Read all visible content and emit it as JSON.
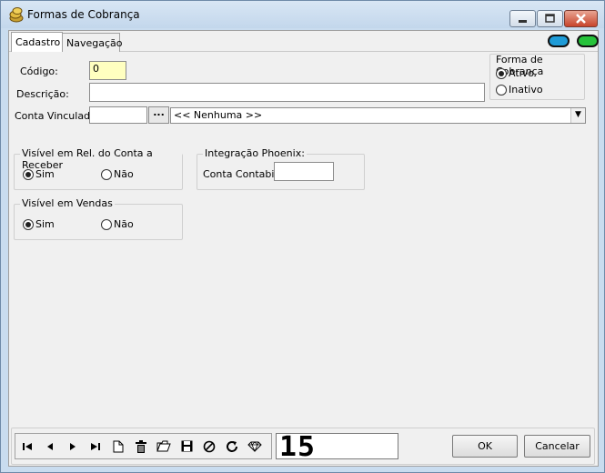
{
  "window": {
    "title": "Formas de Cobrança"
  },
  "tabs": [
    {
      "label": "Cadastro",
      "active": true
    },
    {
      "label": "Navegação",
      "active": false
    }
  ],
  "indicators": {
    "pill1_color": "#1e9bd7",
    "pill2_color": "#26c23a"
  },
  "form": {
    "codigo_label": "Código:",
    "codigo_value": "0",
    "descricao_label": "Descrição:",
    "descricao_value": "",
    "conta_label": "Conta Vinculada:",
    "conta_value": "",
    "conta_button": "...",
    "conta_combo_value": "<< Nenhuma >>"
  },
  "forma_group": {
    "title": "Forma de Cobrança",
    "options": [
      {
        "label": "Ativo",
        "checked": true
      },
      {
        "label": "Inativo",
        "checked": false
      }
    ]
  },
  "visivel_rel_group": {
    "title": "Visível em Rel. do Conta a Receber",
    "options": [
      {
        "label": "Sim",
        "checked": true
      },
      {
        "label": "Não",
        "checked": false
      }
    ]
  },
  "visivel_vendas_group": {
    "title": "Visível em Vendas",
    "options": [
      {
        "label": "Sim",
        "checked": true
      },
      {
        "label": "Não",
        "checked": false
      }
    ]
  },
  "integracao_group": {
    "title": "Integração Phoenix:",
    "conta_contabil_label": "Conta Contabil",
    "conta_contabil_value": ""
  },
  "toolbar": {
    "icons": [
      "first-icon",
      "prev-icon",
      "next-icon",
      "last-icon",
      "new-icon",
      "delete-icon",
      "open-icon",
      "save-icon",
      "cancel-icon",
      "refresh-icon",
      "find-icon"
    ]
  },
  "record_counter": "15",
  "buttons": {
    "ok": "OK",
    "cancel": "Cancelar"
  }
}
